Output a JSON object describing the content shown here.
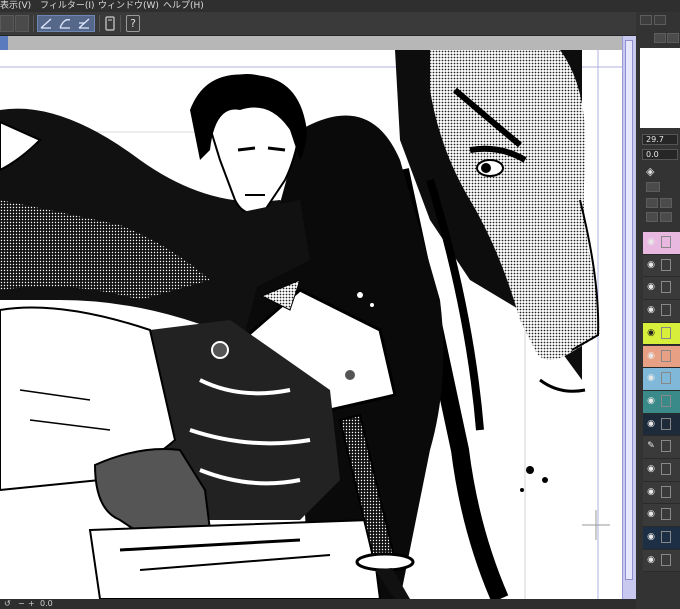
{
  "menu": {
    "items": [
      "表示(V)",
      "フィルター(I)",
      "ウィンドウ(W)",
      "ヘルプ(H)"
    ]
  },
  "toolbar": {
    "help_glyph": "?"
  },
  "right_panel": {
    "size_value": "29.7",
    "zoom_value": "0.0"
  },
  "status_bar": {
    "value": "0.0"
  },
  "layers": [
    {
      "color": "#e8b8e0",
      "icon": "eye-icon"
    },
    {
      "color": "#3a3a3a",
      "icon": "eye-icon"
    },
    {
      "color": "#3a3a3a",
      "icon": "eye-icon"
    },
    {
      "color": "#3a3a3a",
      "icon": "eye-icon"
    },
    {
      "color": "#d7ef3a",
      "icon": "eye-icon"
    },
    {
      "color": "#e8a084",
      "icon": "eye-icon"
    },
    {
      "color": "#7fb8d9",
      "icon": "eye-icon"
    },
    {
      "color": "#3a8a8a",
      "icon": "eye-icon"
    },
    {
      "color": "#1c2a3a",
      "icon": "eye-icon"
    },
    {
      "color": "#3a3a3a",
      "icon": "pen-icon"
    },
    {
      "color": "#3a3a3a",
      "icon": "eye-icon"
    },
    {
      "color": "#3a3a3a",
      "icon": "eye-icon"
    },
    {
      "color": "#3a3a3a",
      "icon": "eye-icon"
    },
    {
      "color": "#1c2f45",
      "icon": "eye-icon"
    },
    {
      "color": "#3a3a3a",
      "icon": "eye-icon"
    }
  ],
  "colors": {
    "accent": "#5b7bbf",
    "scrollbar": "#c9c9f0",
    "panel": "#333333"
  }
}
